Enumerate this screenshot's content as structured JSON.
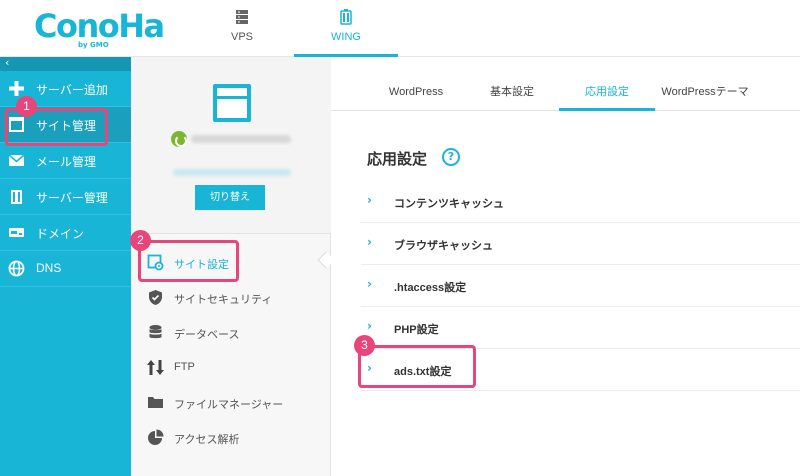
{
  "logo": {
    "name": "ConoHa",
    "sub": "by GMO"
  },
  "top_tabs": [
    {
      "label": "VPS",
      "icon": "server-stack-icon"
    },
    {
      "label": "WING",
      "icon": "wing-icon"
    }
  ],
  "sidebar": {
    "collapse": "‹",
    "items": [
      {
        "label": "サーバー追加",
        "icon": "plus-icon"
      },
      {
        "label": "サイト管理",
        "icon": "window-icon"
      },
      {
        "label": "メール管理",
        "icon": "mail-icon"
      },
      {
        "label": "サーバー管理",
        "icon": "server-icon"
      },
      {
        "label": "ドメイン",
        "icon": "domain-icon"
      },
      {
        "label": "DNS",
        "icon": "globe-icon"
      }
    ]
  },
  "site_card": {
    "switch_label": "切り替え"
  },
  "submenu": [
    {
      "label": "サイト設定",
      "icon": "site-settings-icon"
    },
    {
      "label": "サイトセキュリティ",
      "icon": "shield-icon"
    },
    {
      "label": "データベース",
      "icon": "database-icon"
    },
    {
      "label": "FTP",
      "icon": "transfer-icon"
    },
    {
      "label": "ファイルマネージャー",
      "icon": "folder-icon"
    },
    {
      "label": "アクセス解析",
      "icon": "pie-chart-icon"
    }
  ],
  "tabs": [
    "WordPress",
    "基本設定",
    "応用設定",
    "WordPressテーマ"
  ],
  "section": {
    "title": "応用設定",
    "help": "?"
  },
  "settings": [
    {
      "label": "コンテンツキャッシュ"
    },
    {
      "label": "ブラウザキャッシュ"
    },
    {
      "label": ".htaccess設定"
    },
    {
      "label": "PHP設定"
    },
    {
      "label": "ads.txt設定"
    }
  ],
  "chevron": "›",
  "annotations": [
    "1",
    "2",
    "3"
  ],
  "colors": {
    "accent": "#19b5d6",
    "highlight": "#e8457b",
    "power": "#7cb82f"
  }
}
